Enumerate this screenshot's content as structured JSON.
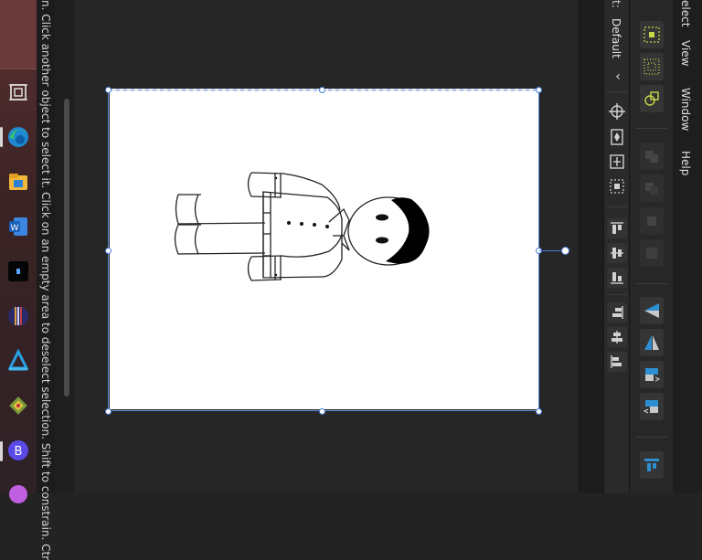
{
  "hint": {
    "text": "n. Click another object to select it. Click on an empty area to deselect selection. Shift to constrain. Ctr"
  },
  "panel": {
    "default_label": "Default",
    "collapse_glyph": "‹"
  },
  "menu": {
    "items": [
      "elect",
      "View",
      "Window",
      "Help"
    ]
  },
  "taskbar": {
    "icons": [
      "canvas-icon",
      "edge-icon",
      "folder-icon",
      "word-icon",
      "terminal-icon",
      "stripe-app-icon",
      "azure-icon",
      "app-icon",
      "bluesky-icon",
      "copilot-icon"
    ]
  },
  "colors": {
    "selection": "#4a7ed6",
    "accent": "#2d8ed0",
    "snap": "#c8d84a"
  }
}
